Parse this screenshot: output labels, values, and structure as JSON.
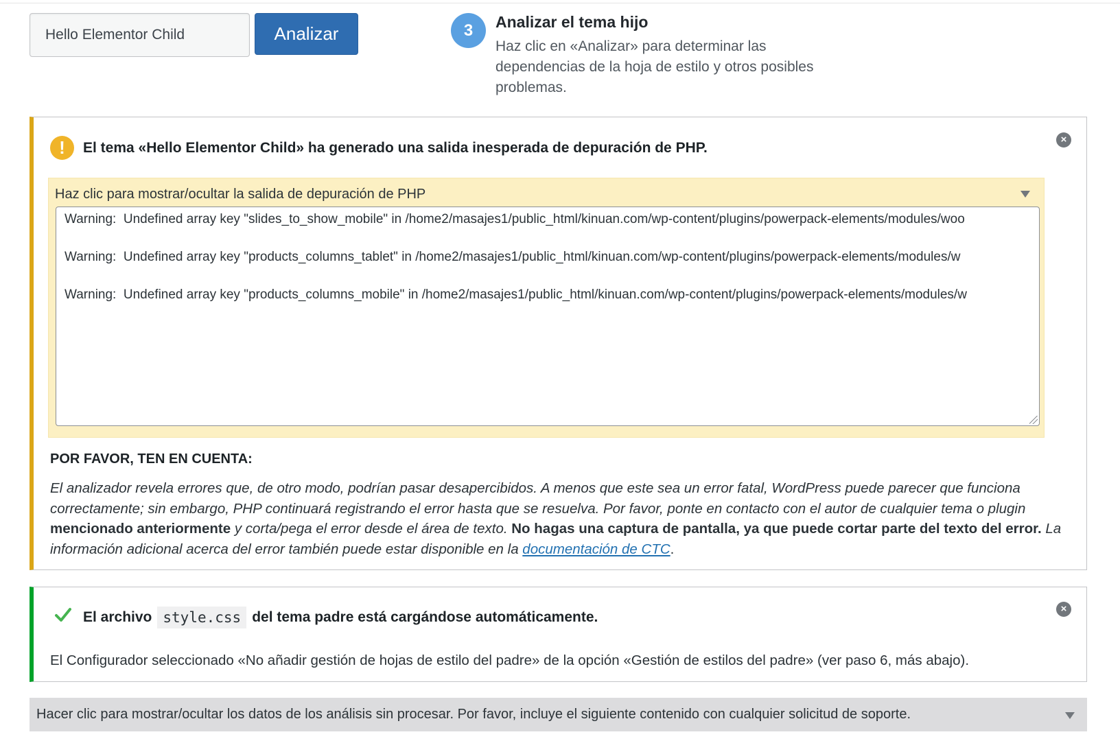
{
  "analyze": {
    "theme_value": "Hello Elementor Child",
    "button_label": "Analizar",
    "step_number": "3",
    "step_title": "Analizar el tema hijo",
    "step_description": "Haz clic en «Analizar» para determinar las dependencias de la hoja de estilo y otros posibles problemas."
  },
  "warning_notice": {
    "title": "El tema «Hello Elementor Child» ha generado una salida inesperada de depuración de PHP.",
    "debug_toggle_label": "Haz clic para mostrar/ocultar la salida de depuración de PHP",
    "debug_lines": [
      "Warning:  Undefined array key \"slides_to_show_mobile\" in /home2/masajes1/public_html/kinuan.com/wp-content/plugins/powerpack-elements/modules/woo",
      "Warning:  Undefined array key \"products_columns_tablet\" in /home2/masajes1/public_html/kinuan.com/wp-content/plugins/powerpack-elements/modules/w",
      "Warning:  Undefined array key \"products_columns_mobile\" in /home2/masajes1/public_html/kinuan.com/wp-content/plugins/powerpack-elements/modules/w"
    ],
    "note_heading": "POR FAVOR, TEN EN CUENTA:",
    "note": {
      "part1": "El analizador revela errores que, de otro modo, podrían pasar desapercibidos. A menos que este sea un error fatal, WordPress puede parecer que funciona correctamente; sin embargo, PHP continuará registrando el error hasta que se resuelva. Por favor, ponte en contacto con el autor de cualquier tema o plugin ",
      "bold1": "mencionado anteriormente",
      "part2": " y corta/pega el error desde el área de texto. ",
      "bold2": "No hagas una captura de pantalla, ya que puede cortar parte del texto del error.",
      "part3": " La información adicional acerca del error también puede estar disponible en la ",
      "link": "documentación de CTC",
      "end": "."
    }
  },
  "success_notice": {
    "title_before": "El archivo",
    "code": "style.css",
    "title_after": "del tema padre está cargándose automáticamente.",
    "description": "El Configurador seleccionado «No añadir gestión de hojas de estilo del padre» de la opción «Gestión de estilos del padre» (ver paso 6, más abajo)."
  },
  "raw_data": {
    "toggle_label": "Hacer clic para mostrar/ocultar los datos de los análisis sin procesar. Por favor, incluye el siguiente contenido con cualquier solicitud de soporte."
  },
  "icons": {
    "warning": "exclamation-circle-icon",
    "success": "checkmark-icon",
    "dismiss": "close-circle-icon",
    "dropdown": "triangle-down-icon"
  },
  "colors": {
    "primary_button": "#2f6db1",
    "step_badge": "#5aa0e1",
    "warning_border": "#dba617",
    "warning_icon": "#f0b429",
    "debug_panel_bg": "#fcf0c3",
    "success_border": "#00a32a",
    "link": "#2271b1",
    "raw_toggle_bg": "#dcdcde"
  }
}
